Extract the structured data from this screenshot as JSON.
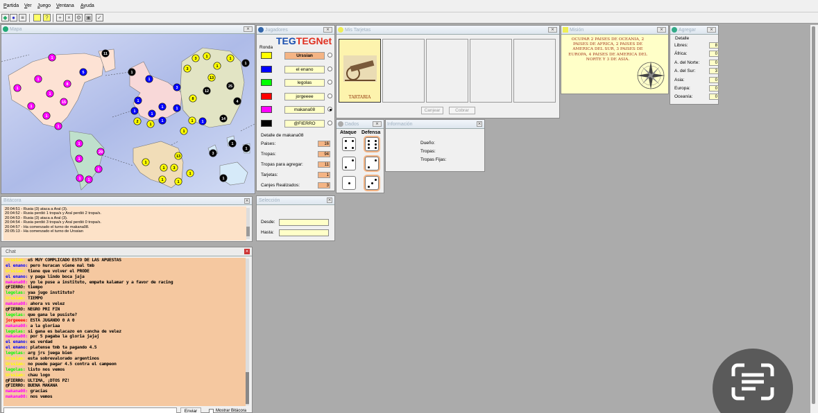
{
  "menu": [
    "Partida",
    "Ver",
    "Juego",
    "Ventana",
    "Ayuda"
  ],
  "toolbar": {
    "icons": [
      "new-game-icon",
      "connect-icon",
      "list-icon",
      "card-icon",
      "help-icon",
      "add-icon",
      "cancel-icon",
      "settings-icon",
      "copy-icon",
      "check-icon"
    ]
  },
  "map_window": {
    "title": "Mapa"
  },
  "players_window": {
    "title": "Jugadores",
    "logo": "TEGNet",
    "logo_mark": "®",
    "round_label": "Ronda",
    "players": [
      {
        "name": "Urssian",
        "color": "#ffff00",
        "active": false,
        "current": true
      },
      {
        "name": "el enano",
        "color": "#0000ff",
        "active": false,
        "current": false
      },
      {
        "name": "legolas",
        "color": "#00ff00",
        "active": false,
        "current": false
      },
      {
        "name": "jorgeeee",
        "color": "#ff0000",
        "active": false,
        "current": false
      },
      {
        "name": "makana08",
        "color": "#ff00ff",
        "active": true,
        "current": false
      },
      {
        "name": "@FIERRO",
        "color": "#000000",
        "active": false,
        "current": false
      }
    ],
    "detail_title": "Detalle de makana08",
    "details": [
      {
        "label": "Paises:",
        "value": "16"
      },
      {
        "label": "Tropas:",
        "value": "94"
      },
      {
        "label": "Tropas para agregar:",
        "value": "11"
      },
      {
        "label": "Tarjetas:",
        "value": "1"
      },
      {
        "label": "Canjes Realizados:",
        "value": "3"
      }
    ]
  },
  "cards_window": {
    "title": "Mis Tarjetas",
    "cards": [
      {
        "name": "TARTARIA"
      }
    ],
    "exchange_button": "Canjear",
    "collect_button": "Cobrar"
  },
  "mission_window": {
    "title": "Misión",
    "text": "OCUPAR 2 PAISES DE OCEANIA, 2 PAISES DE AFRICA, 2 PAISES DE AMERICA DEL SUR, 3 PAISES DE EUROPA, 4 PAISES DE AMERICA DEL NORTE Y 3 DE ASIA."
  },
  "add_window": {
    "title": "Agregar",
    "detail_label": "Detalle",
    "rows": [
      {
        "label": "Libres:",
        "value": "8"
      },
      {
        "label": "África:",
        "value": "0"
      },
      {
        "label": "A. del Norte:",
        "value": "0"
      },
      {
        "label": "A. del Sur:",
        "value": "3"
      },
      {
        "label": "Asia:",
        "value": "0"
      },
      {
        "label": "Europa:",
        "value": "0"
      },
      {
        "label": "Oceanía:",
        "value": "0"
      }
    ]
  },
  "dice_window": {
    "title": "Dados",
    "attack_label": "Ataque",
    "defense_label": "Defensa",
    "attack": [
      4,
      2,
      1
    ],
    "defense": [
      6,
      2,
      3
    ]
  },
  "info_window": {
    "title": "Información",
    "owner_label": "Dueño:",
    "troops_label": "Tropas:",
    "fixed_troops_label": "Tropas Fijas:"
  },
  "selection_window": {
    "title": "Selección",
    "from_label": "Desde:",
    "to_label": "Hasta:",
    "from_value": "",
    "to_value": ""
  },
  "log_window": {
    "title": "Bitácora",
    "entries": [
      "20:04:51 - Rusia (3) ataca a Aral (3).",
      "20:04:52 - Rusia perdió 1 tropa/s y Aral perdió 2 tropa/s.",
      "20:04:53 - Rusia (3) ataca a Aral (3).",
      "20:04:54 - Rusia perdió 3 tropa/s y Aral perdió 0 tropa/s.",
      "20:04:57 - Ha comenzado el turno de makana08.",
      "20:05:13 - Ha comenzado el turno de Urssian"
    ]
  },
  "chat_window": {
    "title": "Chat",
    "send_button": "Enviar",
    "show_log_label": "Mostrar Bitácora",
    "messages": [
      {
        "user": "Urssian",
        "text": "eS MUY COMPLICADO ESTO DE LAS APUESTAS",
        "color": "#ffff00"
      },
      {
        "user": "el enano",
        "text": "pero huracan viene mal tmb",
        "color": "#0000ff"
      },
      {
        "user": "Urssian",
        "text": "tiene que volver el PRODE",
        "color": "#ffff00"
      },
      {
        "user": "el enano",
        "text": "y paga lindo boca jaja",
        "color": "#0000ff"
      },
      {
        "user": "makana08",
        "text": "yo le puse a instituto, empate kalamar y a favor de racing",
        "color": "#ff00ff"
      },
      {
        "user": "@FIERRO",
        "text": "tiempo",
        "color": "#000000"
      },
      {
        "user": "legolas",
        "text": "yaa jugo instituto?",
        "color": "#00ff00"
      },
      {
        "user": "Urssian",
        "text": "TIEMPO",
        "color": "#ffff00"
      },
      {
        "user": "makana08",
        "text": "ahora vs velez",
        "color": "#ff00ff"
      },
      {
        "user": "@FIERRO",
        "text": "NEGRO PRI FIN",
        "color": "#000000"
      },
      {
        "user": "legolas",
        "text": "que gana le pusiste?",
        "color": "#00ff00"
      },
      {
        "user": "jorgeeee",
        "text": "ESTA JUGANDO 0 A 0",
        "color": "#ff0000"
      },
      {
        "user": "makana08",
        "text": "a la gloriaa",
        "color": "#ff00ff"
      },
      {
        "user": "legolas",
        "text": "si gana es balacazo en cancha de velez",
        "color": "#00ff00"
      },
      {
        "user": "makana08",
        "text": "por 5 pagaba la gloria jajaj",
        "color": "#ff00ff"
      },
      {
        "user": "el enano",
        "text": "es verdad",
        "color": "#0000ff"
      },
      {
        "user": "el enano",
        "text": "platense tmb ta pagando 4.5",
        "color": "#0000ff"
      },
      {
        "user": "legolas",
        "text": "arg jrs juega bien",
        "color": "#00ff00"
      },
      {
        "user": "Urssian",
        "text": "esta sobrevalorado argentinos",
        "color": "#ffff00"
      },
      {
        "user": "Urssian",
        "text": "no puede pagar 4.5 contra el campeon",
        "color": "#ffff00"
      },
      {
        "user": "legolas",
        "text": "listo nos vemos",
        "color": "#00ff00"
      },
      {
        "user": "Urssian",
        "text": "chau logo",
        "color": "#ffff00"
      },
      {
        "user": "@FIERRO",
        "text": "ULTIMA, ¡DTOS PZ!",
        "color": "#000000"
      },
      {
        "user": "@FIERRO",
        "text": "BUENA MAKANA",
        "color": "#000000"
      },
      {
        "user": "makana08",
        "text": "gracias",
        "color": "#ff00ff"
      },
      {
        "user": "makana08",
        "text": "nos vemos",
        "color": "#ff00ff"
      }
    ]
  },
  "close_label": "⨯",
  "colors": {
    "europe": "#f8d8d8",
    "asia": "#e2e4c4",
    "america_norte": "#fde2d4",
    "america_sur": "#bfe0cc",
    "africa": "#f1ddb8",
    "oceania": "#d6eaf9",
    "ocean": "#cfd8f2"
  }
}
